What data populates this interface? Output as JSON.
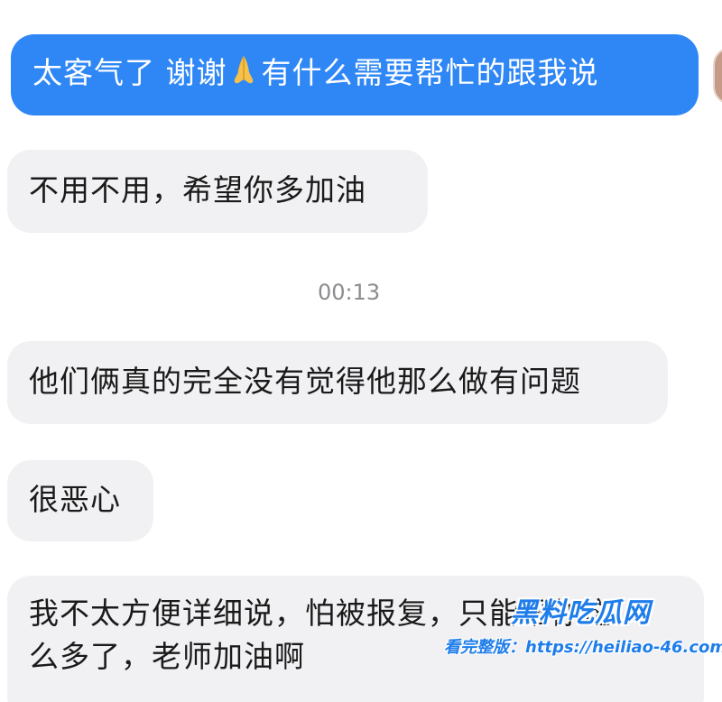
{
  "conversation": {
    "outgoing": [
      {
        "text_before": "太客气了 谢谢",
        "emoji": "folded-hands",
        "text_after": "有什么需要帮忙的跟我说"
      }
    ],
    "incoming": [
      {
        "text": "不用不用，希望你多加油"
      },
      {
        "text": "他们俩真的完全没有觉得他那么做有问题"
      },
      {
        "text": "很恶心"
      },
      {
        "lines": [
          "我不太方便详细说，怕被报复，只能帮你这",
          "么多了，老师加油啊"
        ]
      }
    ],
    "timestamp": "00:13"
  },
  "watermark": {
    "title": "黑料吃瓜网",
    "link": "看完整版：https://heiliao-46.com"
  },
  "colors": {
    "outgoing_bubble": "#2f87f5",
    "incoming_bubble": "#f1f1f3",
    "timestamp_text": "#8b8b90",
    "watermark": "#1f7dea"
  },
  "icons": {
    "emoji": "folded-hands-icon",
    "avatar": "avatar"
  }
}
